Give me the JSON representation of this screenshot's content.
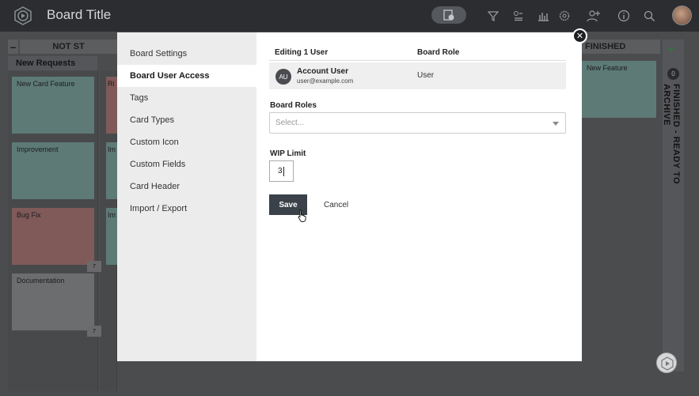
{
  "header": {
    "title": "Board Title",
    "icons": [
      "board-menu-icon",
      "filter-icon",
      "list-icon",
      "chart-icon",
      "gear-icon",
      "add-user-icon",
      "info-icon",
      "search-icon"
    ]
  },
  "board": {
    "lane_title": "NOT ST",
    "lane_finished": "FINISHED",
    "sublane": "New Requests",
    "right_vertical": "FINISHED - READY TO ARCHIVE",
    "right_count": "0",
    "right_card": "New Feature",
    "cards": [
      {
        "title": "New Card Feature",
        "color": "#5d7a76"
      },
      {
        "title": "Improvement",
        "color": "#5d7a76"
      },
      {
        "title": "Bug Fix",
        "color": "#7f5a59"
      },
      {
        "title": "Documentation",
        "color": "#6c6d6f"
      }
    ],
    "col2_cards": [
      "Ri",
      "Im",
      "Im"
    ],
    "badge": "7"
  },
  "modal": {
    "menu": [
      {
        "label": "Board Settings",
        "active": false
      },
      {
        "label": "Board User Access",
        "active": true
      },
      {
        "label": "Tags",
        "active": false
      },
      {
        "label": "Card Types",
        "active": false
      },
      {
        "label": "Custom Icon",
        "active": false
      },
      {
        "label": "Custom Fields",
        "active": false
      },
      {
        "label": "Card Header",
        "active": false
      },
      {
        "label": "Import / Export",
        "active": false
      }
    ],
    "table": {
      "col1": "Editing 1 User",
      "col2": "Board Role",
      "user_initials": "AU",
      "user_name": "Account User",
      "user_email": "user@example.com",
      "user_role": "User"
    },
    "board_roles_label": "Board Roles",
    "board_roles_placeholder": "Select...",
    "wip_label": "WIP Limit",
    "wip_value": "3",
    "save_label": "Save",
    "cancel_label": "Cancel"
  }
}
